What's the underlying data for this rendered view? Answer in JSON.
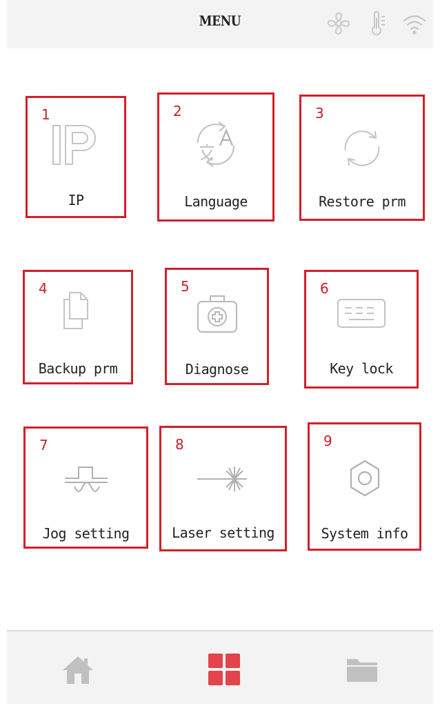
{
  "header": {
    "title": "MENU",
    "status_icons": [
      "fan-icon",
      "temperature-icon",
      "wifi-icon"
    ]
  },
  "tiles": [
    {
      "number": "1",
      "label": "IP",
      "icon": "ip-icon"
    },
    {
      "number": "2",
      "label": "Language",
      "icon": "language-icon"
    },
    {
      "number": "3",
      "label": "Restore prm",
      "icon": "restore-icon"
    },
    {
      "number": "4",
      "label": "Backup prm",
      "icon": "backup-icon"
    },
    {
      "number": "5",
      "label": "Diagnose",
      "icon": "diagnose-icon"
    },
    {
      "number": "6",
      "label": "Key lock",
      "icon": "keyboard-icon"
    },
    {
      "number": "7",
      "label": "Jog setting",
      "icon": "jog-icon"
    },
    {
      "number": "8",
      "label": "Laser setting",
      "icon": "laser-icon"
    },
    {
      "number": "9",
      "label": "System info",
      "icon": "gear-icon"
    }
  ],
  "bottom_nav": [
    {
      "name": "home",
      "icon": "home-icon",
      "active": false
    },
    {
      "name": "menu",
      "icon": "grid-icon",
      "active": true
    },
    {
      "name": "files",
      "icon": "folder-icon",
      "active": false
    }
  ],
  "colors": {
    "accent": "#e3434b",
    "highlight_border": "#d21f2a",
    "icon_gray": "#c4c4c4",
    "bar_background": "#f3f3f3"
  }
}
